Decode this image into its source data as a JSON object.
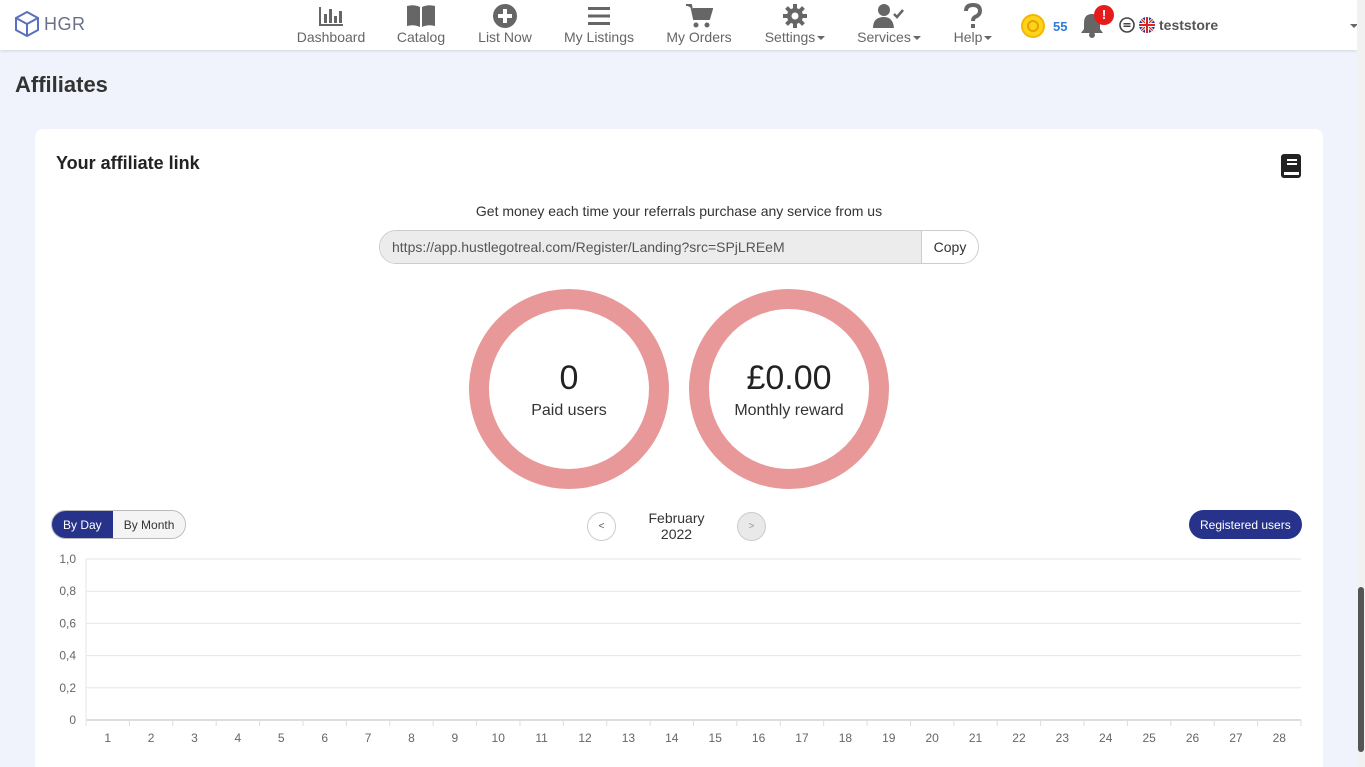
{
  "header": {
    "brand": "HGR",
    "nav": [
      {
        "label": "Dashboard",
        "icon": "bar-chart-icon",
        "dropdown": false
      },
      {
        "label": "Catalog",
        "icon": "book-open-icon",
        "dropdown": false
      },
      {
        "label": "List Now",
        "icon": "plus-circle-icon",
        "dropdown": false
      },
      {
        "label": "My Listings",
        "icon": "list-icon",
        "dropdown": false
      },
      {
        "label": "My Orders",
        "icon": "cart-icon",
        "dropdown": false
      },
      {
        "label": "Settings",
        "icon": "gear-icon",
        "dropdown": true
      },
      {
        "label": "Services",
        "icon": "user-check-icon",
        "dropdown": true
      },
      {
        "label": "Help",
        "icon": "question-icon",
        "dropdown": true
      }
    ],
    "coins": "55",
    "notification_badge": "!",
    "username": "teststore"
  },
  "page": {
    "title": "Affiliates"
  },
  "affiliate": {
    "card_title": "Your affiliate link",
    "tagline": "Get money each time your referrals purchase any service from us",
    "link": "https://app.hustlegotreal.com/Register/Landing?src=SPjLREeM",
    "copy_label": "Copy",
    "paid_users_value": "0",
    "paid_users_label": "Paid users",
    "monthly_reward_value": "£0.00",
    "monthly_reward_label": "Monthly reward",
    "ring_color": "#e89898"
  },
  "controls": {
    "by_day": "By Day",
    "by_month": "By Month",
    "prev": "<",
    "next": ">",
    "month": "February 2022",
    "registered_users": "Registered users",
    "accent_color": "#27338a"
  },
  "chart_data": {
    "type": "bar",
    "categories": [
      "1",
      "2",
      "3",
      "4",
      "5",
      "6",
      "7",
      "8",
      "9",
      "10",
      "11",
      "12",
      "13",
      "14",
      "15",
      "16",
      "17",
      "18",
      "19",
      "20",
      "21",
      "22",
      "23",
      "24",
      "25",
      "26",
      "27",
      "28"
    ],
    "values": [
      0,
      0,
      0,
      0,
      0,
      0,
      0,
      0,
      0,
      0,
      0,
      0,
      0,
      0,
      0,
      0,
      0,
      0,
      0,
      0,
      0,
      0,
      0,
      0,
      0,
      0,
      0,
      0
    ],
    "yticks": [
      "0",
      "0,2",
      "0,4",
      "0,6",
      "0,8",
      "1,0"
    ],
    "ylim": [
      0,
      1
    ],
    "grid": true
  }
}
